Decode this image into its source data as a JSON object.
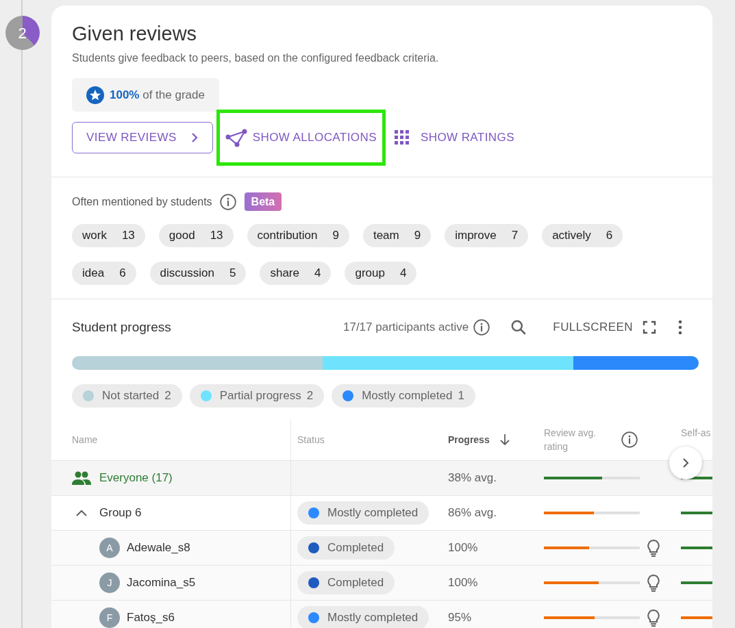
{
  "step": {
    "number": "2"
  },
  "header": {
    "title": "Given reviews",
    "subtitle": "Students give feedback to peers, based on the configured feedback criteria.",
    "grade_value": "100%",
    "grade_text": "of the grade"
  },
  "actions": [
    {
      "kind": "outlined",
      "label": "VIEW REVIEWS",
      "highlighted": false
    },
    {
      "kind": "allocations",
      "label": "SHOW ALLOCATIONS",
      "highlighted": true
    },
    {
      "kind": "ratings",
      "label": "SHOW RATINGS",
      "highlighted": false
    }
  ],
  "mentions": {
    "label": "Often mentioned by students",
    "badge": "Beta",
    "words": [
      {
        "word": "work",
        "count": "13"
      },
      {
        "word": "good",
        "count": "13"
      },
      {
        "word": "contribution",
        "count": "9"
      },
      {
        "word": "team",
        "count": "9"
      },
      {
        "word": "improve",
        "count": "7"
      },
      {
        "word": "actively",
        "count": "6"
      },
      {
        "word": "idea",
        "count": "6"
      },
      {
        "word": "discussion",
        "count": "5"
      },
      {
        "word": "share",
        "count": "4"
      },
      {
        "word": "group",
        "count": "4"
      }
    ]
  },
  "progress": {
    "title": "Student progress",
    "active": "17/17 participants active",
    "fullscreen": "FULLSCREEN",
    "legend": [
      {
        "label": "Not started",
        "count": "2",
        "color": "#b7d2d9"
      },
      {
        "label": "Partial progress",
        "count": "2",
        "color": "#6fe3fd"
      },
      {
        "label": "Mostly completed",
        "count": "1",
        "color": "#2b89fb"
      }
    ]
  },
  "table": {
    "columns": [
      "Name",
      "Status",
      "Progress",
      "Review avg. rating",
      "Self-as"
    ],
    "rows": [
      {
        "kind": "everyone",
        "name": "Everyone (17)",
        "progress": "38% avg.",
        "review": {
          "level": 0.61,
          "color": "#2e7d32"
        },
        "self": {
          "color": "#2e7d32"
        }
      },
      {
        "kind": "group",
        "name": "Group 6",
        "expanded": true,
        "status": {
          "label": "Mostly completed",
          "color": "#2d89ff"
        },
        "progress": "86% avg.",
        "review": {
          "level": 0.52,
          "color": "#ef6c00"
        },
        "self": {
          "color": "#2e7d32"
        }
      },
      {
        "kind": "student",
        "initial": "A",
        "name": "Adewale_s8",
        "status": {
          "label": "Completed",
          "color": "#1e5bbf"
        },
        "progress": "100%",
        "review": {
          "level": 0.47,
          "color": "#ef6c00"
        },
        "self": {
          "color": "#2e7d32"
        }
      },
      {
        "kind": "student",
        "initial": "J",
        "name": "Jacomina_s5",
        "status": {
          "label": "Completed",
          "color": "#1e5bbf"
        },
        "progress": "100%",
        "review": {
          "level": 0.57,
          "color": "#ef6c00"
        },
        "self": {
          "color": "#2e7d32"
        }
      },
      {
        "kind": "student",
        "initial": "F",
        "name": "Fatoş_s6",
        "status": {
          "label": "Mostly completed",
          "color": "#2d89ff"
        },
        "progress": "95%",
        "review": {
          "level": 0.53,
          "color": "#ef6c00"
        },
        "self": {
          "color": "#ef6c00"
        }
      }
    ]
  }
}
